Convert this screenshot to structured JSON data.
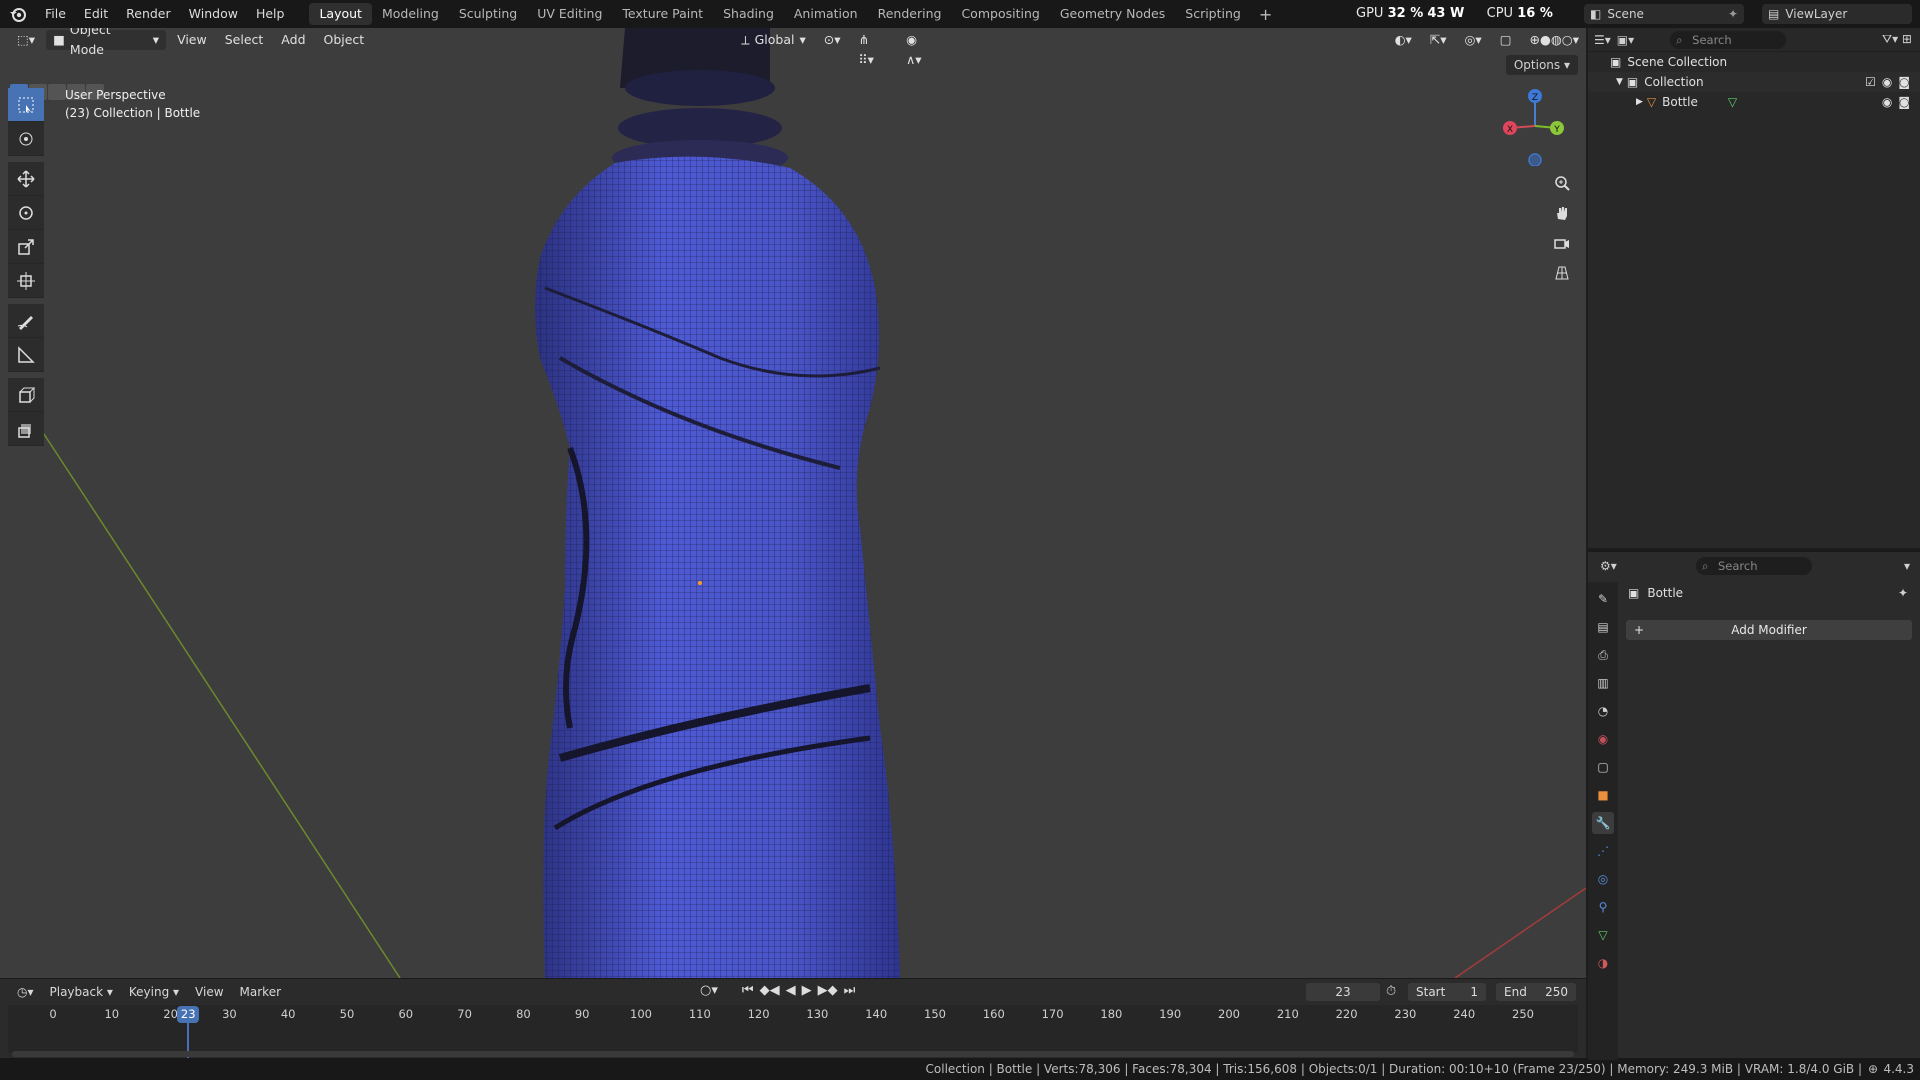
{
  "menu": [
    "File",
    "Edit",
    "Render",
    "Window",
    "Help"
  ],
  "workspaces": [
    "Layout",
    "Modeling",
    "Sculpting",
    "UV Editing",
    "Texture Paint",
    "Shading",
    "Animation",
    "Rendering",
    "Compositing",
    "Geometry Nodes",
    "Scripting"
  ],
  "stats": {
    "gpu_label": "GPU",
    "gpu_value": "32 %",
    "gpu_watts": "43 W",
    "cpu_label": "CPU",
    "cpu_value": "16 %"
  },
  "scene": {
    "name": "Scene",
    "view_layer": "ViewLayer"
  },
  "viewport": {
    "mode": "Object Mode",
    "menus": [
      "View",
      "Select",
      "Add",
      "Object"
    ],
    "orientation": "Global",
    "options": "Options",
    "info_line1": "User Perspective",
    "info_line2": "(23) Collection | Bottle",
    "gizmo": {
      "x": "X",
      "y": "Y",
      "z": "Z"
    },
    "mesh_color": "#4a55c8"
  },
  "timeline": {
    "menus": [
      "Playback",
      "Keying",
      "View",
      "Marker"
    ],
    "current_frame": "23",
    "start_label": "Start",
    "start": "1",
    "end_label": "End",
    "end": "250",
    "ticks": [
      "0",
      "10",
      "20",
      "30",
      "40",
      "50",
      "60",
      "70",
      "80",
      "90",
      "100",
      "110",
      "120",
      "130",
      "140",
      "150",
      "160",
      "170",
      "180",
      "190",
      "200",
      "210",
      "220",
      "230",
      "240",
      "250"
    ]
  },
  "outliner": {
    "search_placeholder": "Search",
    "scene_collection": "Scene Collection",
    "collection": "Collection",
    "object": "Bottle"
  },
  "properties": {
    "search_placeholder": "Search",
    "object": "Bottle",
    "add_modifier": "Add Modifier"
  },
  "status": {
    "text": "Collection | Bottle | Verts:78,306 | Faces:78,304 | Tris:156,608 | Objects:0/1 | Duration: 00:10+10 (Frame 23/250) | Memory: 249.3 MiB | VRAM: 1.8/4.0 GiB |",
    "version": "4.4.3"
  }
}
